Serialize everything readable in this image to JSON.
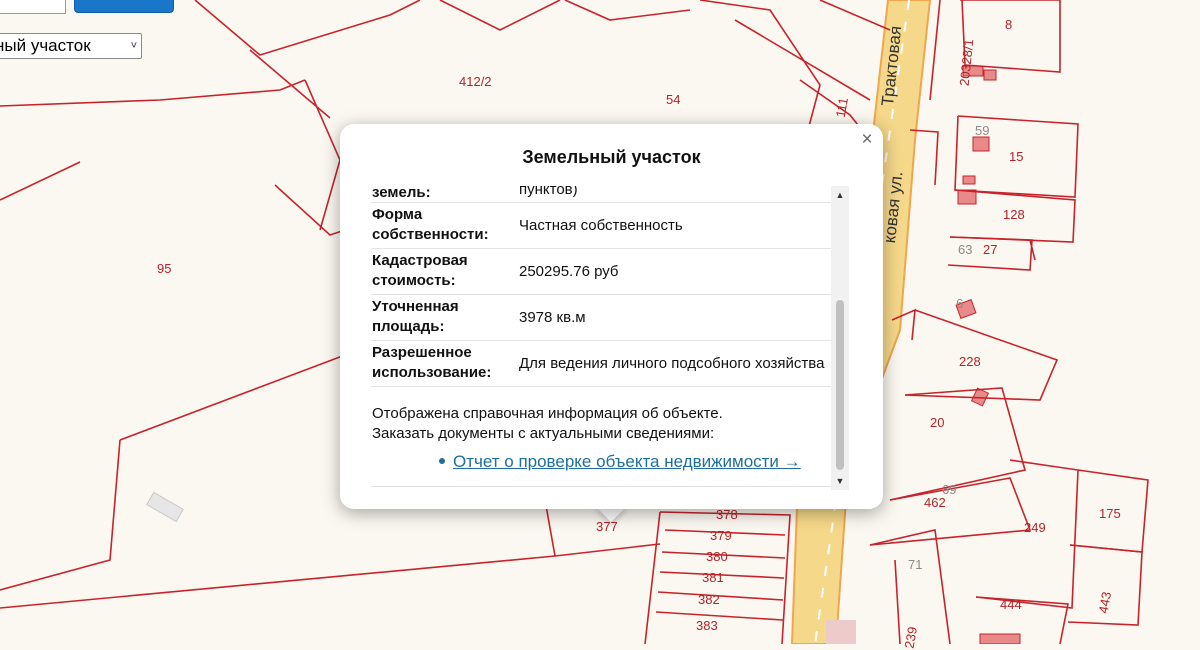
{
  "search": {
    "input_value": "",
    "button_label": ""
  },
  "layer_select": {
    "selected": "ный участок",
    "chevron": "˅"
  },
  "map": {
    "street_labels": [
      "Трактовая",
      "ковая ул."
    ],
    "parcel_labels": [
      "412/2",
      "54",
      "95",
      "111",
      "8",
      "15",
      "128",
      "27",
      "228",
      "20",
      "462",
      "249",
      "175",
      "443",
      "444",
      "239",
      "378",
      "379",
      "380",
      "381",
      "382",
      "383",
      "377",
      "20328/1"
    ],
    "house_labels": [
      "59",
      "63",
      "69",
      "71",
      "6"
    ],
    "colors": {
      "parcel_line": "#c8232c",
      "road": "#f6d88a",
      "road_edge": "#f0a64c",
      "building": "#e88a8a",
      "background": "#fbf8f1"
    }
  },
  "popup": {
    "title": "Земельный участок",
    "close_icon": "×",
    "rows": [
      {
        "key": "земель:",
        "value": "пунктов)"
      },
      {
        "key": "Форма собственности:",
        "value": "Частная собственность"
      },
      {
        "key": "Кадастровая стоимость:",
        "value": "250295.76 руб"
      },
      {
        "key": "Уточненная площадь:",
        "value": "3978 кв.м"
      },
      {
        "key": "Разрешенное использование:",
        "value": "Для ведения личного подсобного хозяйства"
      }
    ],
    "info_line1": "Отображена справочная информация об объекте.",
    "info_line2": "Заказать документы с актуальными сведениями:",
    "report_link": "Отчет о проверке объекта недвижимости →",
    "link_color": "#1e6f9a"
  }
}
